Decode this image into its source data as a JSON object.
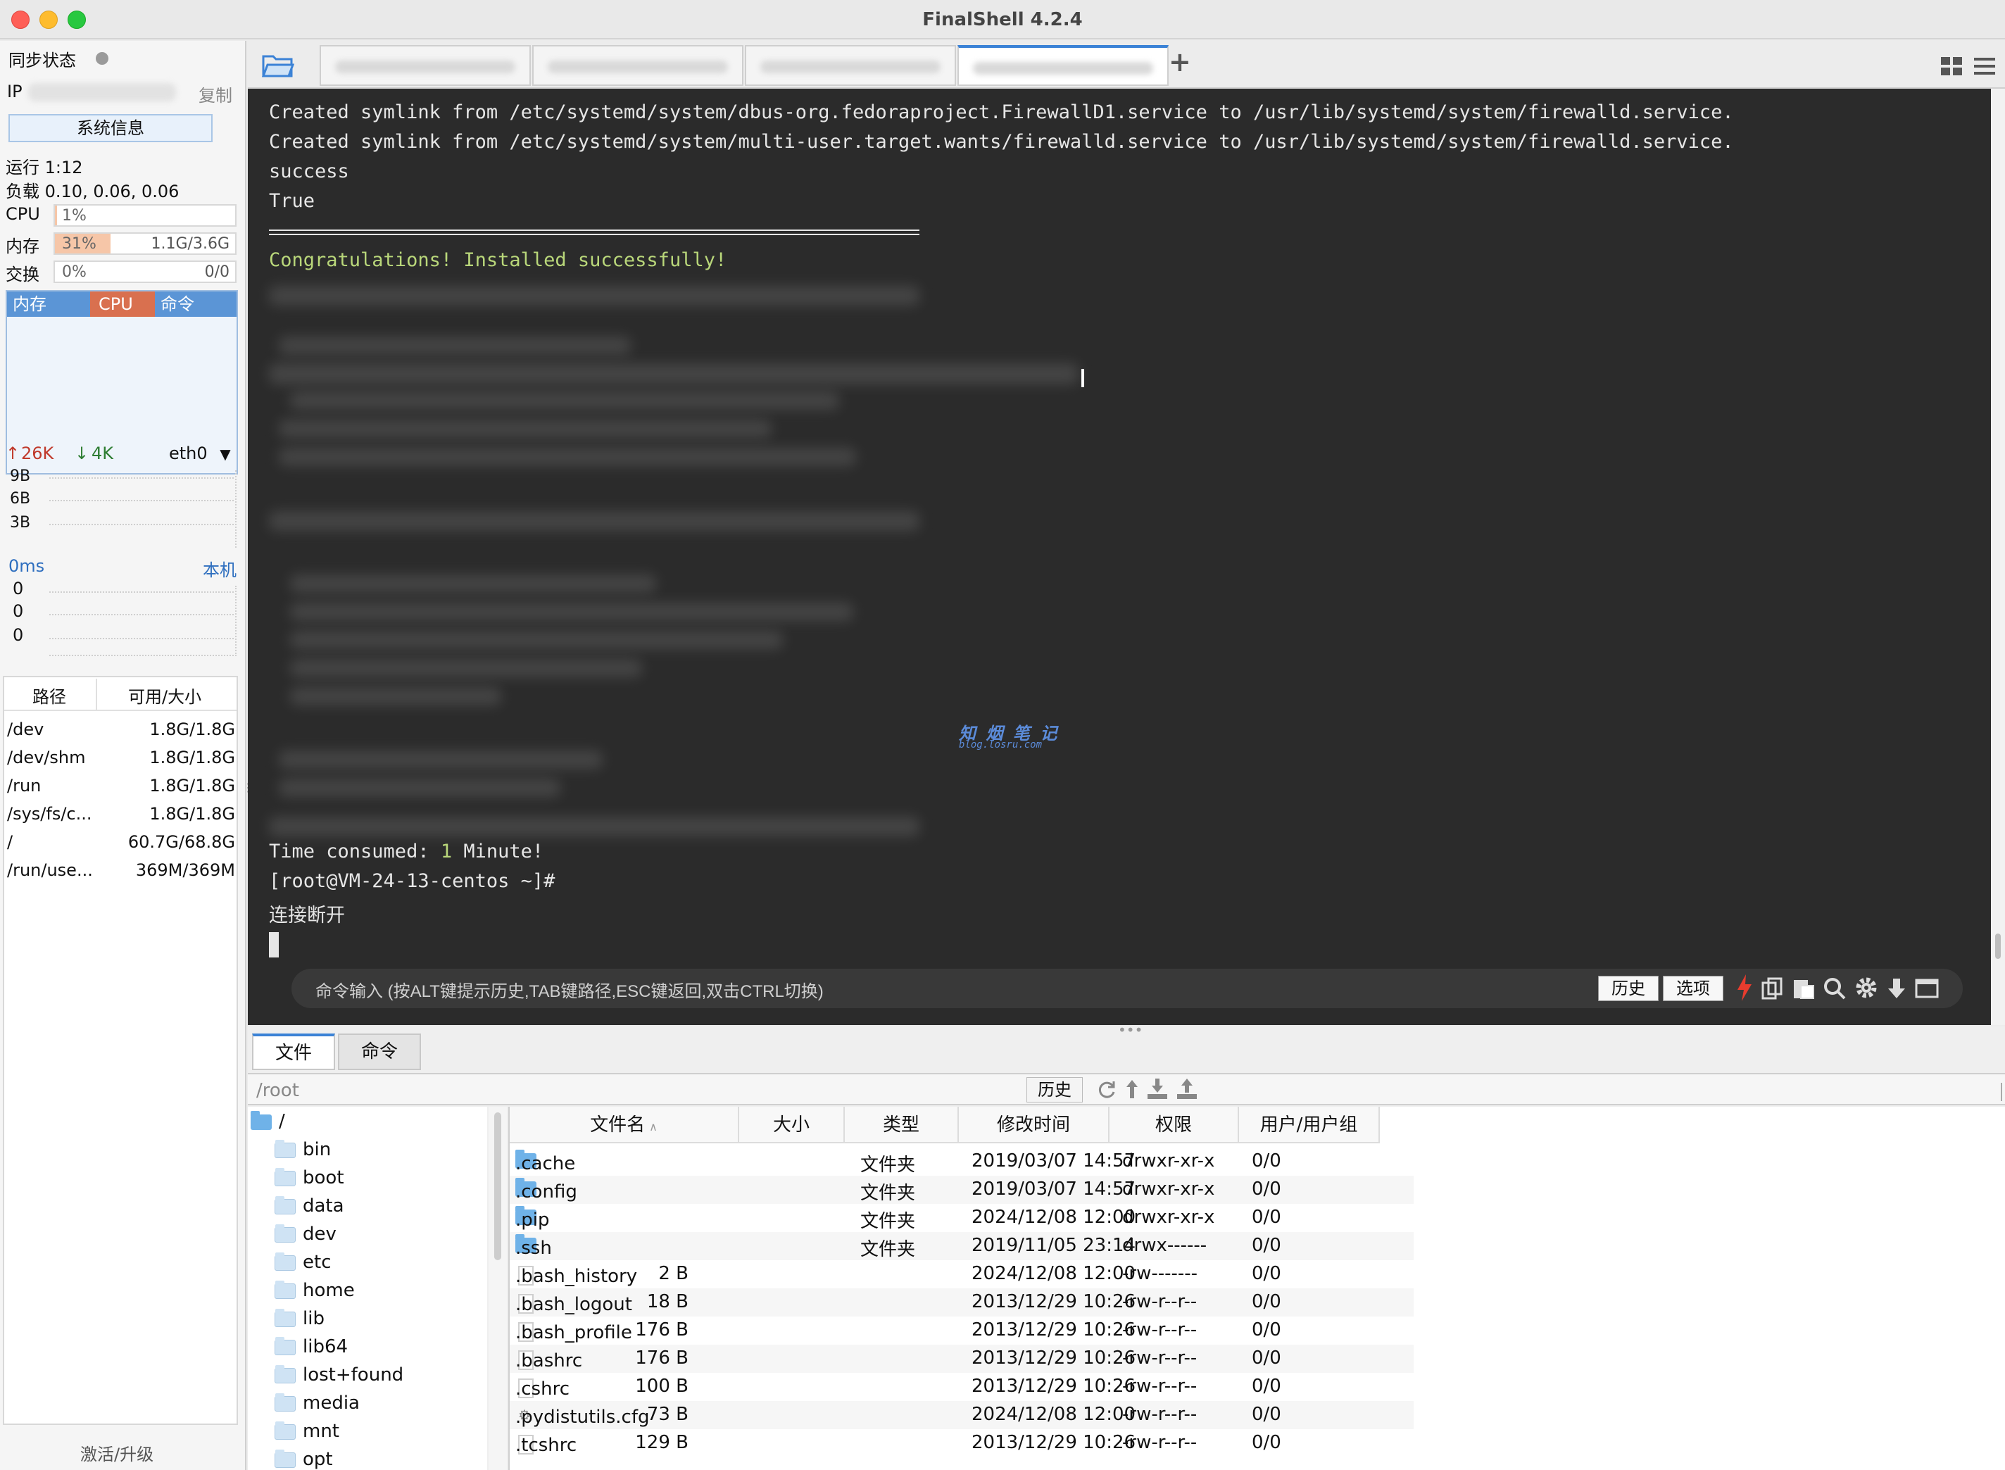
{
  "window": {
    "title": "FinalShell 4.2.4"
  },
  "left": {
    "sync_label": "同步状态",
    "ip_label": "IP",
    "copy_label": "复制",
    "sysinfo_button": "系统信息",
    "uptime": "运行 1:12",
    "load": "负载 0.10, 0.06, 0.06",
    "cpu": {
      "label": "CPU",
      "pct": "1%",
      "value": 0.01
    },
    "mem": {
      "label": "内存",
      "pct": "31%",
      "value": 0.31,
      "size": "1.1G/3.6G"
    },
    "swap": {
      "label": "交换",
      "pct": "0%",
      "value": 0,
      "size": "0/0"
    },
    "proc_tabs": [
      "内存",
      "CPU",
      "命令"
    ],
    "net": {
      "up": "26K",
      "down": "4K",
      "iface": "eth0",
      "scale": [
        "9B",
        "6B",
        "3B"
      ]
    },
    "ping": {
      "latency": "0ms",
      "target": "本机",
      "scale": [
        "0",
        "0",
        "0"
      ]
    },
    "disk": {
      "headers": [
        "路径",
        "可用/大小"
      ],
      "rows": [
        {
          "path": "/dev",
          "size": "1.8G/1.8G"
        },
        {
          "path": "/dev/shm",
          "size": "1.8G/1.8G"
        },
        {
          "path": "/run",
          "size": "1.8G/1.8G"
        },
        {
          "path": "/sys/fs/c...",
          "size": "1.8G/1.8G"
        },
        {
          "path": "/",
          "size": "60.7G/68.8G"
        },
        {
          "path": "/run/use...",
          "size": "369M/369M"
        }
      ]
    },
    "activate_label": "激活/升级"
  },
  "tabs": {
    "add_label": "+"
  },
  "terminal": {
    "lines": [
      "Created symlink from /etc/systemd/system/dbus-org.fedoraproject.FirewallD1.service to /usr/lib/systemd/system/firewalld.service.",
      "Created symlink from /etc/systemd/system/multi-user.target.wants/firewalld.service to /usr/lib/systemd/system/firewalld.service.",
      "success",
      "True"
    ],
    "congrats": "Congratulations! Installed successfully!",
    "watermark_title": "知 烟 笔 记",
    "watermark_sub": "blog.losru.com",
    "time_prefix": "Time consumed: ",
    "time_value": "1",
    "time_suffix": " Minute!",
    "prompt": "[root@VM-24-13-centos ~]#",
    "disconnected": "连接断开",
    "cmd_placeholder": "命令输入 (按ALT键提示历史,TAB键路径,ESC键返回,双击CTRL切换)",
    "history_button": "历史",
    "options_button": "选项"
  },
  "bottom": {
    "tabs": [
      "文件",
      "命令"
    ],
    "path": "/root",
    "history_button": "历史",
    "tree": [
      "/",
      "bin",
      "boot",
      "data",
      "dev",
      "etc",
      "home",
      "lib",
      "lib64",
      "lost+found",
      "media",
      "mnt",
      "opt"
    ],
    "headers": {
      "name": "文件名",
      "size": "大小",
      "type": "类型",
      "mtime": "修改时间",
      "perm": "权限",
      "owner": "用户/用户组"
    },
    "files": [
      {
        "name": ".cache",
        "size": "",
        "type": "文件夹",
        "mtime": "2019/03/07 14:57",
        "perm": "drwxr-xr-x",
        "owner": "0/0",
        "kind": "folder"
      },
      {
        "name": ".config",
        "size": "",
        "type": "文件夹",
        "mtime": "2019/03/07 14:57",
        "perm": "drwxr-xr-x",
        "owner": "0/0",
        "kind": "folder"
      },
      {
        "name": ".pip",
        "size": "",
        "type": "文件夹",
        "mtime": "2024/12/08 12:00",
        "perm": "drwxr-xr-x",
        "owner": "0/0",
        "kind": "folder"
      },
      {
        "name": ".ssh",
        "size": "",
        "type": "文件夹",
        "mtime": "2019/11/05 23:14",
        "perm": "drwx------",
        "owner": "0/0",
        "kind": "folder"
      },
      {
        "name": ".bash_history",
        "size": "2 B",
        "type": "",
        "mtime": "2024/12/08 12:00",
        "perm": "-rw-------",
        "owner": "0/0",
        "kind": "file"
      },
      {
        "name": ".bash_logout",
        "size": "18 B",
        "type": "",
        "mtime": "2013/12/29 10:26",
        "perm": "-rw-r--r--",
        "owner": "0/0",
        "kind": "file"
      },
      {
        "name": ".bash_profile",
        "size": "176 B",
        "type": "",
        "mtime": "2013/12/29 10:26",
        "perm": "-rw-r--r--",
        "owner": "0/0",
        "kind": "file"
      },
      {
        "name": ".bashrc",
        "size": "176 B",
        "type": "",
        "mtime": "2013/12/29 10:26",
        "perm": "-rw-r--r--",
        "owner": "0/0",
        "kind": "file"
      },
      {
        "name": ".cshrc",
        "size": "100 B",
        "type": "",
        "mtime": "2013/12/29 10:26",
        "perm": "-rw-r--r--",
        "owner": "0/0",
        "kind": "file"
      },
      {
        "name": ".pydistutils.cfg",
        "size": "73 B",
        "type": "",
        "mtime": "2024/12/08 12:00",
        "perm": "-rw-r--r--",
        "owner": "0/0",
        "kind": "cfg"
      },
      {
        "name": ".tcshrc",
        "size": "129 B",
        "type": "",
        "mtime": "2013/12/29 10:26",
        "perm": "-rw-r--r--",
        "owner": "0/0",
        "kind": "file"
      }
    ]
  },
  "colors": {
    "terminal_bg": "#2b2b2b",
    "congrats": "#b9d77a",
    "time_value": "#b9d77a",
    "proc_header": "#5b95d6",
    "proc_cpu": "#d9704f",
    "net_up": "#c0392b",
    "net_down": "#2e7d32",
    "folder": "#6fb2e8",
    "watermark": "#5b8bd9"
  }
}
